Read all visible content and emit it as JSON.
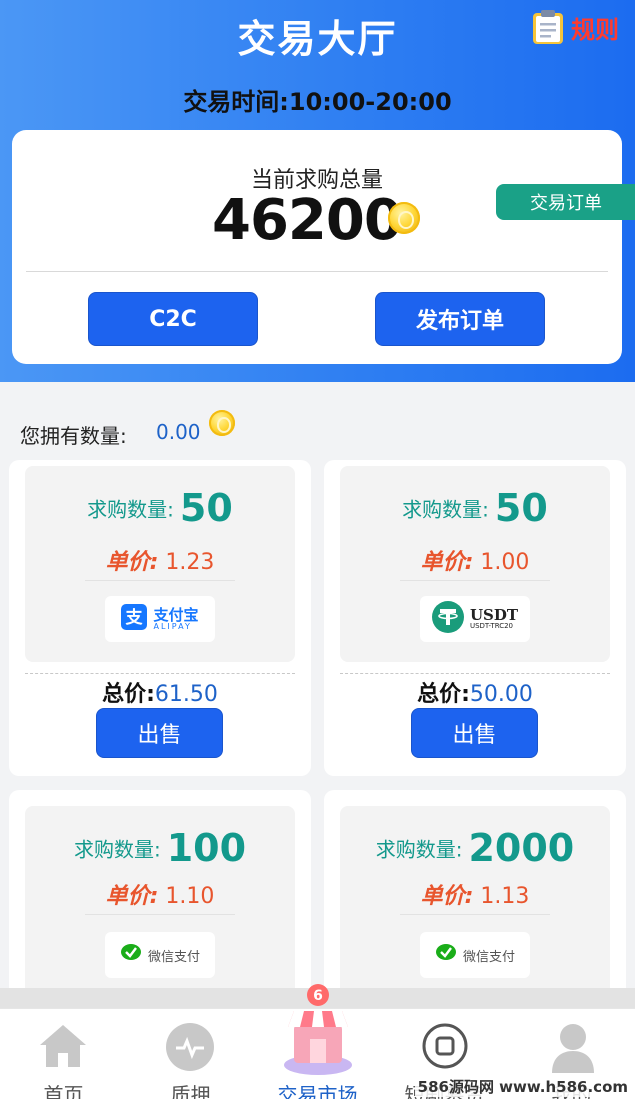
{
  "header": {
    "title": "交易大厅",
    "rules_label": "规则",
    "hours": "交易时间:10:00-20:00"
  },
  "summary": {
    "label": "当前求购总量",
    "total": "46200",
    "orders_tab": "交易订单",
    "c2c_button": "C2C",
    "publish_button": "发布订单"
  },
  "balance": {
    "label": "您拥有数量:",
    "value": "0.00"
  },
  "listings": [
    {
      "qty_label": "求购数量:",
      "qty": "50",
      "price_label": "单价:",
      "price": "1.23",
      "payment": {
        "name": "支付宝",
        "sub": "ALIPAY",
        "icon": "alipay-icon"
      },
      "total_label": "总价:",
      "total": "61.50",
      "action": "出售"
    },
    {
      "qty_label": "求购数量:",
      "qty": "50",
      "price_label": "单价:",
      "price": "1.00",
      "payment": {
        "name": "USDT",
        "sub": "USDT-TRC20",
        "icon": "tether-icon"
      },
      "total_label": "总价:",
      "total": "50.00",
      "action": "出售"
    },
    {
      "qty_label": "求购数量:",
      "qty": "100",
      "price_label": "单价:",
      "price": "1.10",
      "payment": {
        "name": "微信支付",
        "icon": "wechat-pay-icon"
      }
    },
    {
      "qty_label": "求购数量:",
      "qty": "2000",
      "price_label": "单价:",
      "price": "1.13",
      "payment": {
        "name": "微信支付",
        "icon": "wechat-pay-icon"
      }
    }
  ],
  "tabbar": {
    "items": [
      {
        "label": "首页",
        "icon": "home-icon"
      },
      {
        "label": "质押",
        "icon": "pulse-icon"
      },
      {
        "label": "交易市场",
        "icon": "market-store-icon",
        "active": true
      },
      {
        "label": "短剧募资",
        "icon": "square-circle-icon"
      },
      {
        "label": "我的",
        "icon": "user-icon"
      }
    ]
  },
  "watermark": "586源码网 www.h586.com",
  "colors": {
    "primary": "#1d63ef",
    "teal": "#13998c",
    "price": "#e8552d",
    "rules": "#ff3b2f"
  }
}
